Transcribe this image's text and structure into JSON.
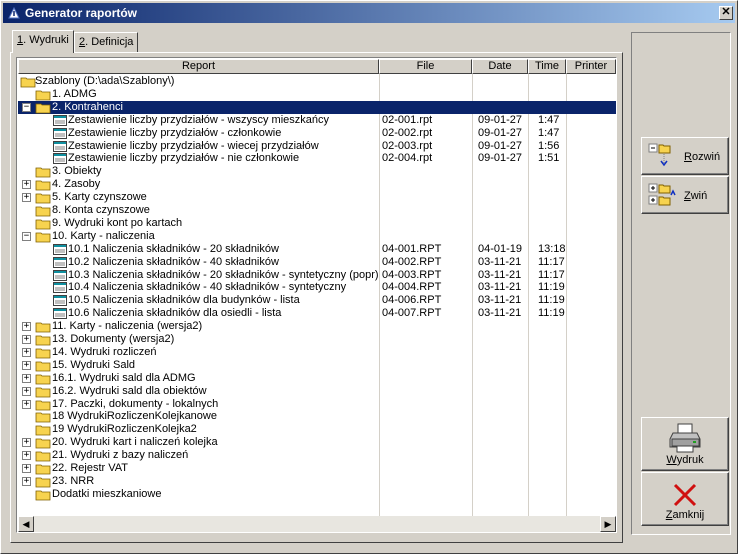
{
  "window": {
    "title": "Generator raportów",
    "close_glyph": "✕"
  },
  "tabs": [
    {
      "key": "1",
      "rest": ". Wydruki"
    },
    {
      "key": "2",
      "rest": ". Definicja"
    }
  ],
  "columns": [
    "Report",
    "File",
    "Date",
    "Time",
    "Printer"
  ],
  "rows": [
    {
      "label": "Szablony (D:\\ada\\Szablony\\)",
      "type": "root",
      "level": 0,
      "file": "",
      "date": "",
      "time": ""
    },
    {
      "label": "1. ADMG",
      "type": "folder",
      "level": 1,
      "expander": "",
      "file": "",
      "date": "",
      "time": ""
    },
    {
      "label": "2. Kontrahenci",
      "type": "folder",
      "level": 1,
      "expander": "−",
      "selected": true,
      "file": "",
      "date": "",
      "time": ""
    },
    {
      "label": "Zestawienie liczby przydziałów - wszyscy mieszkańcy",
      "type": "report",
      "level": 2,
      "file": "02-001.rpt",
      "date": "09-01-27",
      "time": "1:47"
    },
    {
      "label": "Zestawienie liczby przydziałów - członkowie",
      "type": "report",
      "level": 2,
      "file": "02-002.rpt",
      "date": "09-01-27",
      "time": "1:47"
    },
    {
      "label": "Zestawienie liczby przydziałów - wiecej przydziałów",
      "type": "report",
      "level": 2,
      "file": "02-003.rpt",
      "date": "09-01-27",
      "time": "1:56"
    },
    {
      "label": "Zestawienie liczby przydziałów - nie członkowie",
      "type": "report",
      "level": 2,
      "file": "02-004.rpt",
      "date": "09-01-27",
      "time": "1:51"
    },
    {
      "label": "3. Obiekty",
      "type": "folder",
      "level": 1,
      "expander": "",
      "file": "",
      "date": "",
      "time": ""
    },
    {
      "label": "4. Zasoby",
      "type": "folder",
      "level": 1,
      "expander": "+",
      "file": "",
      "date": "",
      "time": ""
    },
    {
      "label": "5. Karty czynszowe",
      "type": "folder",
      "level": 1,
      "expander": "+",
      "file": "",
      "date": "",
      "time": ""
    },
    {
      "label": "8. Konta czynszowe",
      "type": "folder",
      "level": 1,
      "expander": "",
      "file": "",
      "date": "",
      "time": ""
    },
    {
      "label": "9. Wydruki kont po kartach",
      "type": "folder",
      "level": 1,
      "expander": "",
      "file": "",
      "date": "",
      "time": ""
    },
    {
      "label": "10. Karty - naliczenia",
      "type": "folder",
      "level": 1,
      "expander": "−",
      "file": "",
      "date": "",
      "time": ""
    },
    {
      "label": "10.1 Naliczenia składników  - 20 składników",
      "type": "report",
      "level": 2,
      "file": "04-001.RPT",
      "date": "04-01-19",
      "time": "13:18"
    },
    {
      "label": "10.2 Naliczenia składników  - 40 składników",
      "type": "report",
      "level": 2,
      "file": "04-002.RPT",
      "date": "03-11-21",
      "time": "11:17"
    },
    {
      "label": "10.3 Naliczenia składników  - 20 składników - syntetyczny (popr)",
      "type": "report",
      "level": 2,
      "file": "04-003.RPT",
      "date": "03-11-21",
      "time": "11:17"
    },
    {
      "label": "10.4 Naliczenia składników  - 40 składników - syntetyczny",
      "type": "report",
      "level": 2,
      "file": "04-004.RPT",
      "date": "03-11-21",
      "time": "11:19"
    },
    {
      "label": "10.5 Naliczenia składników dla budynków - lista",
      "type": "report",
      "level": 2,
      "file": "04-006.RPT",
      "date": "03-11-21",
      "time": "11:19"
    },
    {
      "label": "10.6 Naliczenia składników dla osiedli - lista",
      "type": "report",
      "level": 2,
      "file": "04-007.RPT",
      "date": "03-11-21",
      "time": "11:19"
    },
    {
      "label": "11. Karty - naliczenia (wersja2)",
      "type": "folder",
      "level": 1,
      "expander": "+",
      "file": "",
      "date": "",
      "time": ""
    },
    {
      "label": "13. Dokumenty (wersja2)",
      "type": "folder",
      "level": 1,
      "expander": "+",
      "file": "",
      "date": "",
      "time": ""
    },
    {
      "label": "14. Wydruki rozliczeń",
      "type": "folder",
      "level": 1,
      "expander": "+",
      "file": "",
      "date": "",
      "time": ""
    },
    {
      "label": "15. Wydruki Sald",
      "type": "folder",
      "level": 1,
      "expander": "+",
      "file": "",
      "date": "",
      "time": ""
    },
    {
      "label": "16.1. Wydruki sald dla ADMG",
      "type": "folder",
      "level": 1,
      "expander": "+",
      "file": "",
      "date": "",
      "time": ""
    },
    {
      "label": "16.2. Wydruki sald dla obiektów",
      "type": "folder",
      "level": 1,
      "expander": "+",
      "file": "",
      "date": "",
      "time": ""
    },
    {
      "label": "17. Paczki, dokumenty - lokalnych",
      "type": "folder",
      "level": 1,
      "expander": "+",
      "file": "",
      "date": "",
      "time": ""
    },
    {
      "label": "18 WydrukiRozliczenKolejkanowe",
      "type": "folder",
      "level": 1,
      "expander": "",
      "file": "",
      "date": "",
      "time": ""
    },
    {
      "label": "19 WydrukiRozliczenKolejka2",
      "type": "folder",
      "level": 1,
      "expander": "",
      "file": "",
      "date": "",
      "time": ""
    },
    {
      "label": "20. Wydruki kart i naliczeń kolejka",
      "type": "folder",
      "level": 1,
      "expander": "+",
      "file": "",
      "date": "",
      "time": ""
    },
    {
      "label": "21. Wydruki z bazy naliczeń",
      "type": "folder",
      "level": 1,
      "expander": "+",
      "file": "",
      "date": "",
      "time": ""
    },
    {
      "label": "22. Rejestr VAT",
      "type": "folder",
      "level": 1,
      "expander": "+",
      "file": "",
      "date": "",
      "time": ""
    },
    {
      "label": "23. NRR",
      "type": "folder",
      "level": 1,
      "expander": "+",
      "file": "",
      "date": "",
      "time": ""
    },
    {
      "label": "Dodatki mieszkaniowe",
      "type": "folder",
      "level": 1,
      "expander": "",
      "file": "",
      "date": "",
      "time": ""
    }
  ],
  "scrollbar": {
    "left_arrow": "◀",
    "right_arrow": "▶"
  },
  "side_buttons": {
    "expand": {
      "key": "R",
      "rest": "ozwiń",
      "icon": "tree-expand-icon"
    },
    "collapse": {
      "key": "Z",
      "rest": "wiń",
      "icon": "tree-collapse-icon"
    },
    "print": {
      "key": "W",
      "rest": "ydruk",
      "icon": "printer-icon"
    },
    "close": {
      "key": "Z",
      "rest": "amknij",
      "icon": "red-x-icon"
    }
  },
  "colors": {
    "title_start": "#0a246a",
    "title_end": "#a6caf0",
    "selection": "#0a246a",
    "folder": "#f7d34f",
    "close_x": "#d01010"
  }
}
